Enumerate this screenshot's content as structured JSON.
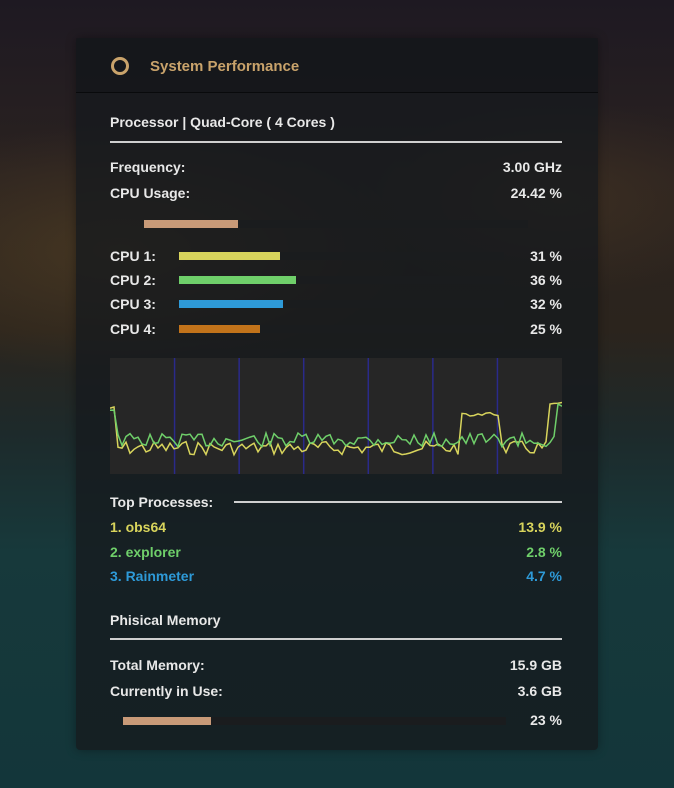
{
  "widget": {
    "title": "System Performance",
    "icon": "circle-ring-icon"
  },
  "processor": {
    "heading": "Processor  |  Quad-Core  ( 4  Cores )",
    "frequency_label": "Frequency:",
    "frequency_value": "3.00 GHz",
    "usage_label": "CPU Usage:",
    "usage_value": "24.42 %",
    "usage_fraction": 0.2442,
    "cores": [
      {
        "label": "CPU 1:",
        "value": "31 %",
        "fraction": 0.31,
        "color": "#d8d45c"
      },
      {
        "label": "CPU 2:",
        "value": "36 %",
        "fraction": 0.36,
        "color": "#6fcf6a"
      },
      {
        "label": "CPU 3:",
        "value": "32 %",
        "fraction": 0.32,
        "color": "#2e9ad8"
      },
      {
        "label": "CPU 4:",
        "value": "25 %",
        "fraction": 0.25,
        "color": "#c2731a"
      }
    ]
  },
  "processes": {
    "heading": "Top Processes:",
    "items": [
      {
        "name": "1. obs64",
        "value": "13.9 %",
        "color": "#d8d45c"
      },
      {
        "name": "2. explorer",
        "value": "2.8 %",
        "color": "#6fcf6a"
      },
      {
        "name": "3. Rainmeter",
        "value": "4.7 %",
        "color": "#2e9ad8"
      }
    ]
  },
  "memory": {
    "heading": "Phisical Memory",
    "total_label": "Total Memory:",
    "total_value": "15.9 GB",
    "in_use_label": "Currently in Use:",
    "in_use_value": "3.6 GB",
    "usage_value": "23 %",
    "usage_fraction": 0.23
  },
  "colors": {
    "accent": "#c9a36b",
    "bar_usage": "#c89a78",
    "graph_grid": "#2a2a8a",
    "graph_line_1": "#d8d45c",
    "graph_line_2": "#6fcf6a"
  }
}
